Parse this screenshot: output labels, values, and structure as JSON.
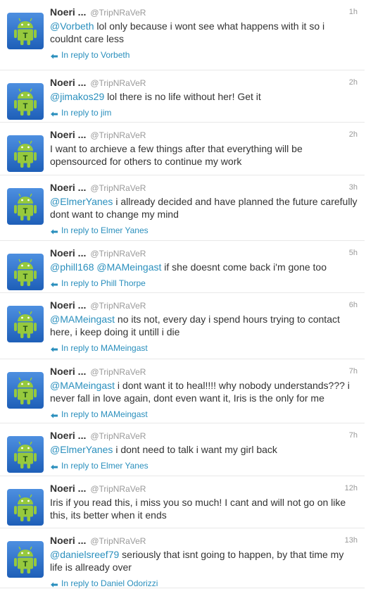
{
  "colors": {
    "accent": "#2a8fbd",
    "avatar_bg": "#1e5fb8",
    "android_green": "#96c93d"
  },
  "avatar_letter": "T",
  "tweets": [
    {
      "name": "Noeri ...",
      "handle": "@TripNRaVeR",
      "time": "1h",
      "mentions": [
        "@Vorbeth"
      ],
      "text": "lol only because i wont see what happens with it so i couldnt care less",
      "reply_to": "In reply to Vorbeth"
    },
    {
      "name": "Noeri ...",
      "handle": "@TripNRaVeR",
      "time": "2h",
      "mentions": [
        "@jimakos29"
      ],
      "text": "lol there is no life without her! Get it",
      "reply_to": "In reply to jim"
    },
    {
      "name": "Noeri ...",
      "handle": "@TripNRaVeR",
      "time": "2h",
      "mentions": [],
      "text": "I want to archieve a few things after that everything will be opensourced for others to continue my work",
      "reply_to": ""
    },
    {
      "name": "Noeri ...",
      "handle": "@TripNRaVeR",
      "time": "3h",
      "mentions": [
        "@ElmerYanes"
      ],
      "text": "i allready decided and have planned the future carefully dont want to change my mind",
      "reply_to": "In reply to Elmer Yanes"
    },
    {
      "name": "Noeri ...",
      "handle": "@TripNRaVeR",
      "time": "5h",
      "mentions": [
        "@phill168",
        "@MAMeingast"
      ],
      "text": "if she doesnt come back i'm gone too",
      "reply_to": "In reply to Phill Thorpe"
    },
    {
      "name": "Noeri ...",
      "handle": "@TripNRaVeR",
      "time": "6h",
      "mentions": [
        "@MAMeingast"
      ],
      "text": "no its not, every day i spend hours trying to contact here, i keep doing it untill i die",
      "reply_to": "In reply to MAMeingast"
    },
    {
      "name": "Noeri ...",
      "handle": "@TripNRaVeR",
      "time": "7h",
      "mentions": [
        "@MAMeingast"
      ],
      "text": "i dont want it to heal!!!! why nobody understands??? i never fall in love again, dont even want it, Iris is the only for me",
      "reply_to": "In reply to MAMeingast"
    },
    {
      "name": "Noeri ...",
      "handle": "@TripNRaVeR",
      "time": "7h",
      "mentions": [
        "@ElmerYanes"
      ],
      "text": "i dont need to talk i want my girl back",
      "reply_to": "In reply to Elmer Yanes"
    },
    {
      "name": "Noeri ...",
      "handle": "@TripNRaVeR",
      "time": "12h",
      "mentions": [],
      "text": "Iris if you read this, i miss you so much! I cant and will not go on like this, its better when it ends",
      "reply_to": ""
    },
    {
      "name": "Noeri ...",
      "handle": "@TripNRaVeR",
      "time": "13h",
      "mentions": [
        "@danielsreef79"
      ],
      "text": "seriously that isnt going to happen, by that time my life is allready over",
      "reply_to": "In reply to Daniel Odorizzi"
    }
  ]
}
